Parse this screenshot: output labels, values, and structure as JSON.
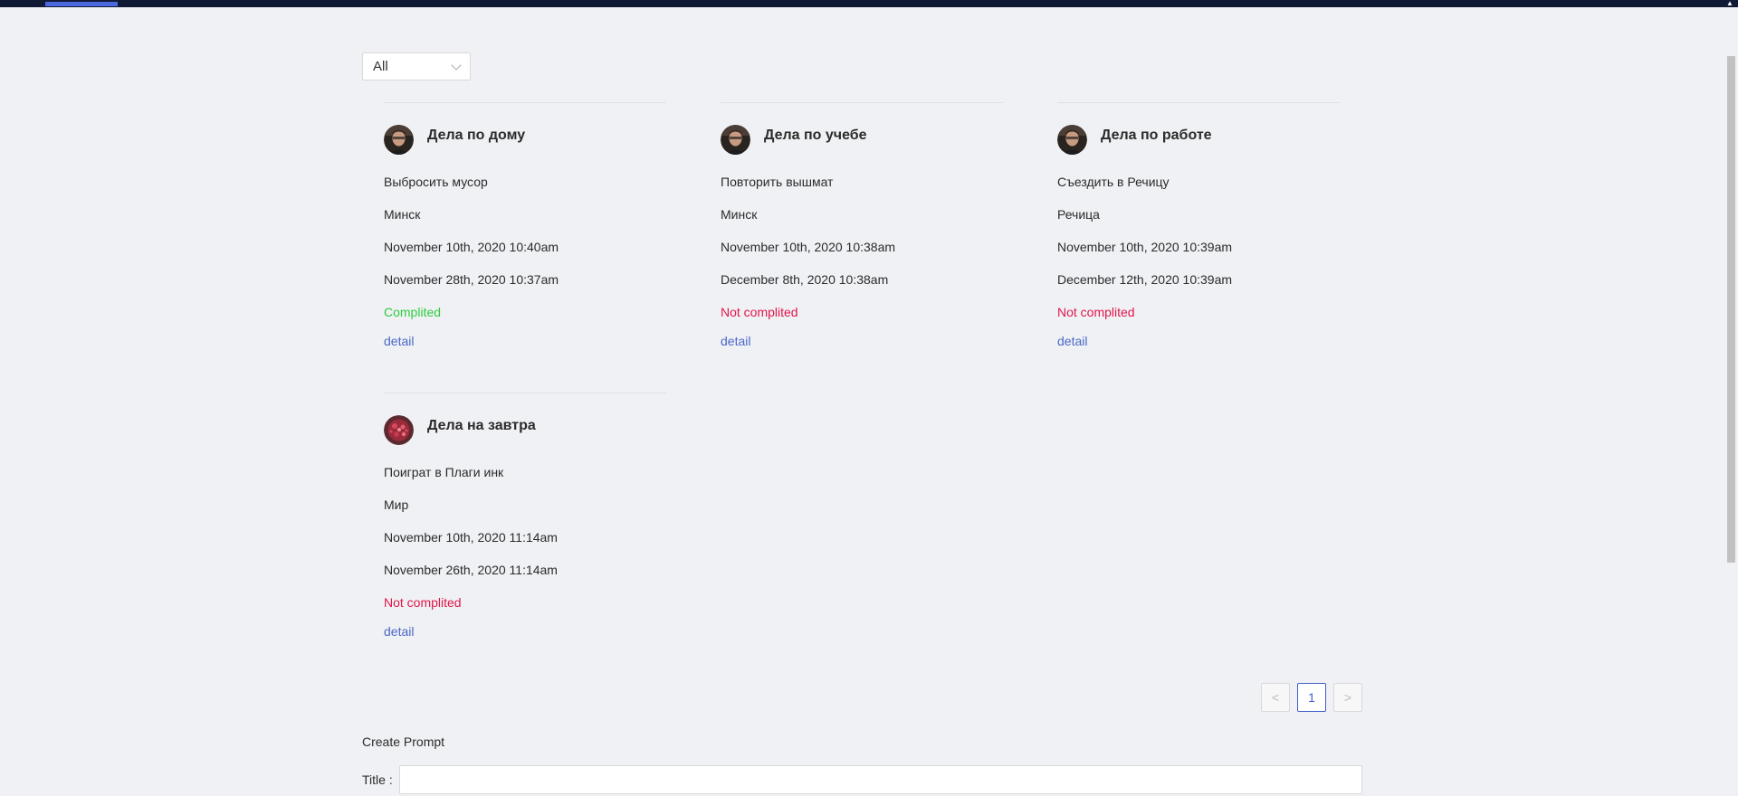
{
  "filter": {
    "selected": "All"
  },
  "cards": [
    {
      "title": "Дела по дому",
      "task": "Выбросить мусор",
      "place": "Минск",
      "created": "November 10th, 2020 10:40am",
      "due": "November 28th, 2020 10:37am",
      "status": "Complited",
      "status_kind": "ok",
      "detail": "detail",
      "avatar": "person-avatar"
    },
    {
      "title": "Дела по учебе",
      "task": "Повторить вышмат",
      "place": "Минск",
      "created": "November 10th, 2020 10:38am",
      "due": "December 8th, 2020 10:38am",
      "status": "Not complited",
      "status_kind": "bad",
      "detail": "detail",
      "avatar": "person-avatar"
    },
    {
      "title": "Дела по работе",
      "task": "Съездить в Речицу",
      "place": "Речица",
      "created": "November 10th, 2020 10:39am",
      "due": "December 12th, 2020 10:39am",
      "status": "Not complited",
      "status_kind": "bad",
      "detail": "detail",
      "avatar": "person-avatar"
    },
    {
      "title": "Дела на завтра",
      "task": "Поиграт в Плаги инк",
      "place": "Мир",
      "created": "November 10th, 2020 11:14am",
      "due": "November 26th, 2020 11:14am",
      "status": "Not complited",
      "status_kind": "bad",
      "detail": "detail",
      "avatar": "virus-avatar"
    }
  ],
  "pagination": {
    "prev": "<",
    "current": "1",
    "next": ">"
  },
  "form": {
    "heading": "Create Prompt",
    "title_label": "Title :",
    "title_value": ""
  },
  "colors": {
    "ok": "#2ecc40",
    "bad": "#e0174b",
    "link": "#4a68c8",
    "accent": "#3f5fcf",
    "topbar": "#111a35"
  }
}
